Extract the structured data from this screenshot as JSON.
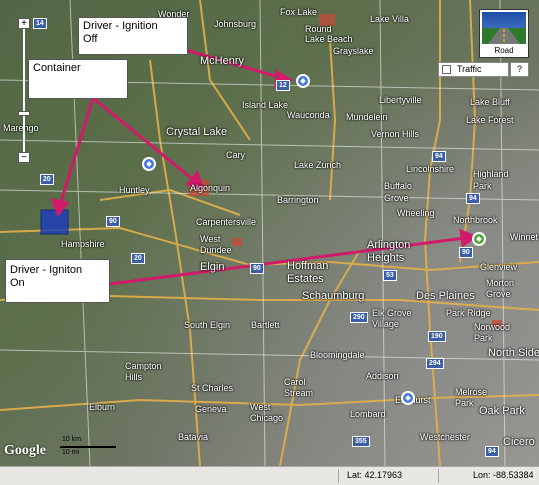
{
  "map": {
    "type": "road",
    "places": [
      {
        "name": "Wonder Lake",
        "label": "Wonder"
      },
      {
        "name": "Johnsburg",
        "label": "Johnsburg"
      },
      {
        "name": "Fox Lake",
        "label": "Fox Lake"
      },
      {
        "name": "Lake Villa",
        "label": "Lake Villa"
      },
      {
        "name": "Round Lake Beach",
        "label": "Round\nLake Beach"
      },
      {
        "name": "Grayslake",
        "label": "Grayslake"
      },
      {
        "name": "McHenry",
        "label": "McHenry"
      },
      {
        "name": "Island Lake",
        "label": "Island Lake"
      },
      {
        "name": "Wauconda",
        "label": "Wauconda"
      },
      {
        "name": "Libertyville",
        "label": "Libertyville"
      },
      {
        "name": "Lake Bluff",
        "label": "Lake Bluff"
      },
      {
        "name": "Mundelein",
        "label": "Mundelein"
      },
      {
        "name": "Lake Forest",
        "label": "Lake Forest"
      },
      {
        "name": "Vernon Hills",
        "label": "Vernon Hills"
      },
      {
        "name": "Crystal Lake",
        "label": "Crystal Lake"
      },
      {
        "name": "Cary",
        "label": "Cary"
      },
      {
        "name": "Lake Zurich",
        "label": "Lake Zurich"
      },
      {
        "name": "Lincolnshire",
        "label": "Lincolnshire"
      },
      {
        "name": "Highland Park",
        "label": "Highland\nPark"
      },
      {
        "name": "Huntley",
        "label": "Huntley"
      },
      {
        "name": "Algonquin",
        "label": "Algonquin"
      },
      {
        "name": "Buffalo Grove",
        "label": "Buffalo\nGrove"
      },
      {
        "name": "Barrington",
        "label": "Barrington"
      },
      {
        "name": "Wheeling",
        "label": "Wheeling"
      },
      {
        "name": "Northbrook",
        "label": "Northbrook"
      },
      {
        "name": "Carpentersville",
        "label": "Carpentersville"
      },
      {
        "name": "West Dundee",
        "label": "West\nDundee"
      },
      {
        "name": "Hampshire",
        "label": "Hampshire"
      },
      {
        "name": "Arlington Heights",
        "label": "Arlington\nHeights"
      },
      {
        "name": "Winnetka",
        "label": "Winnet"
      },
      {
        "name": "Glenview",
        "label": "Glenview"
      },
      {
        "name": "Hoffman Estates",
        "label": "Hoffman\nEstates"
      },
      {
        "name": "Elgin",
        "label": "Elgin"
      },
      {
        "name": "Schaumburg",
        "label": "Schaumburg"
      },
      {
        "name": "Des Plaines",
        "label": "Des Plaines"
      },
      {
        "name": "Morton Grove",
        "label": "Morton\nGrove"
      },
      {
        "name": "Elk Grove Village",
        "label": "Elk Grove\nVillage"
      },
      {
        "name": "Park Ridge",
        "label": "Park Ridge"
      },
      {
        "name": "South Elgin",
        "label": "South Elgin"
      },
      {
        "name": "Bartlett",
        "label": "Bartlett"
      },
      {
        "name": "Norwood Park",
        "label": "Norwood\nPark"
      },
      {
        "name": "North Side",
        "label": "North Side"
      },
      {
        "name": "Bloomingdale",
        "label": "Bloomingdale"
      },
      {
        "name": "Campton Hills",
        "label": "Campton\nHills"
      },
      {
        "name": "Addison",
        "label": "Addison"
      },
      {
        "name": "Melrose Park",
        "label": "Melrose\nPark"
      },
      {
        "name": "St Charles",
        "label": "St Charles"
      },
      {
        "name": "Carol Stream",
        "label": "Carol\nStream"
      },
      {
        "name": "Elmhurst",
        "label": "Elmhurst"
      },
      {
        "name": "Oak Park",
        "label": "Oak Park"
      },
      {
        "name": "Geneva",
        "label": "Geneva"
      },
      {
        "name": "West Chicago",
        "label": "West\nChicago"
      },
      {
        "name": "Lombard",
        "label": "Lombard"
      },
      {
        "name": "Elburn",
        "label": "Elburn"
      },
      {
        "name": "Batavia",
        "label": "Batavia"
      },
      {
        "name": "Westchester",
        "label": "Westchester"
      },
      {
        "name": "Cicero",
        "label": "Cicero"
      },
      {
        "name": "Marengo",
        "label": "Marengo"
      }
    ],
    "shields": [
      "14",
      "12",
      "20",
      "90",
      "94",
      "94",
      "20",
      "90",
      "90",
      "53",
      "290",
      "190",
      "355",
      "294",
      "94"
    ],
    "callouts": {
      "ignition_off": "Driver - Ignition\nOff",
      "container": "Container",
      "ignition_on": "Driver - Igniton\nOn"
    },
    "controls": {
      "zoom_in": "+",
      "zoom_out": "−",
      "road_label": "Road",
      "traffic_label": "Traffic",
      "help_label": "?"
    },
    "logo": "Google",
    "scale": {
      "top": "10 km",
      "bottom": "10 mi"
    },
    "colors": {
      "arrow": "#d11a6a",
      "marker_blue": "#4a78e0",
      "marker_green": "#4caa3c",
      "container_fill": "#1f3fb8"
    }
  },
  "status": {
    "lat": "Lat: 42.17963",
    "lon": "Lon: -88.53384"
  }
}
